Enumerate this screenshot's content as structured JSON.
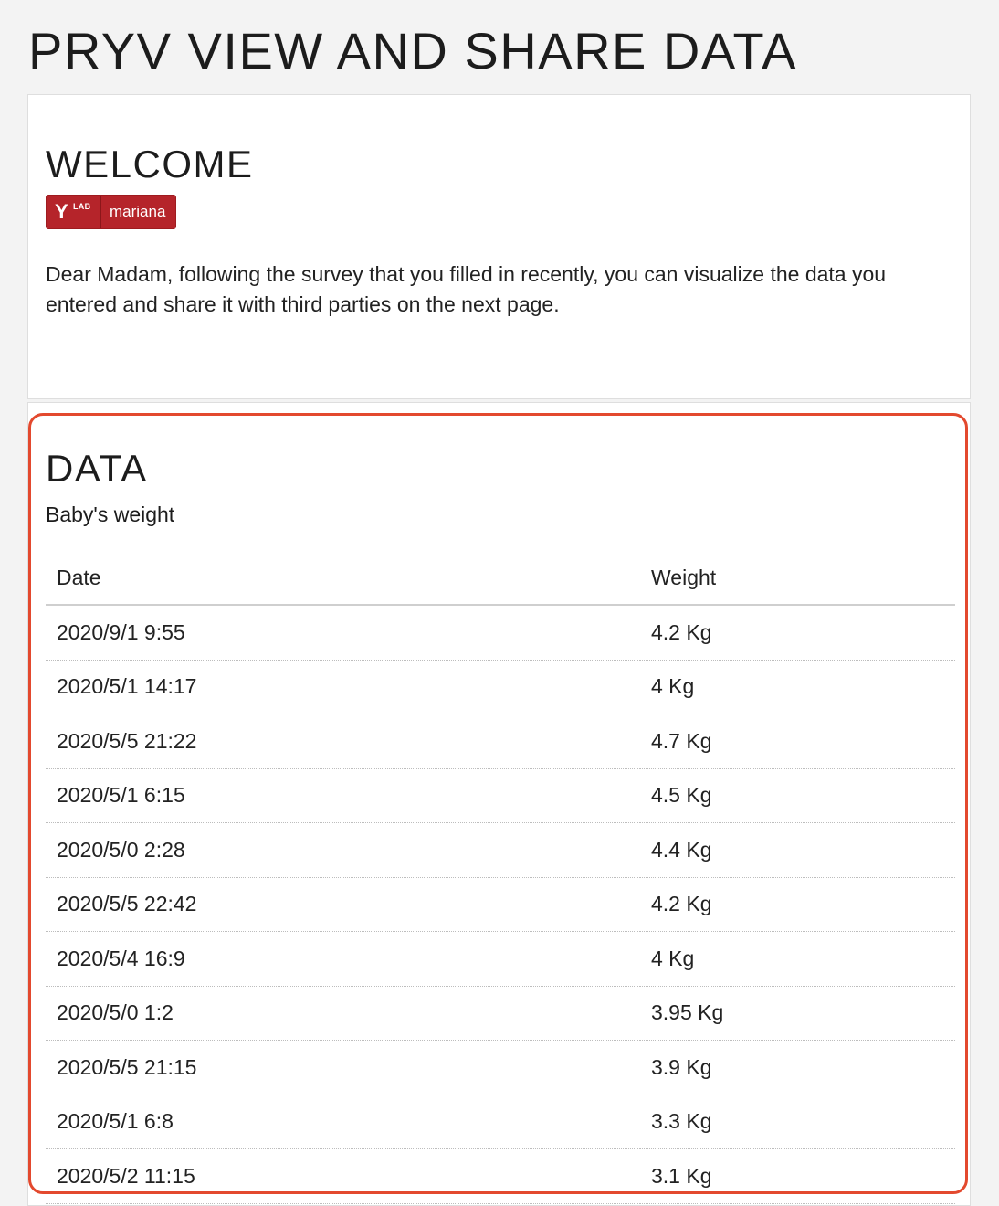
{
  "page": {
    "title": "PRYV VIEW AND SHARE DATA"
  },
  "welcome": {
    "heading": "WELCOME",
    "badge": {
      "logo_letter": "Y",
      "logo_sub": "LAB",
      "username": "mariana",
      "color": "#b5242a"
    },
    "message": "Dear Madam, following the survey that you filled in recently, you can visualize the data you entered and share it with third parties on the next page."
  },
  "data": {
    "heading": "DATA",
    "subheading": "Baby's weight",
    "highlight_color": "#e3492e",
    "table": {
      "headers": [
        "Date",
        "Weight"
      ],
      "rows": [
        [
          "2020/9/1 9:55",
          "4.2 Kg"
        ],
        [
          "2020/5/1 14:17",
          "4 Kg"
        ],
        [
          "2020/5/5 21:22",
          "4.7 Kg"
        ],
        [
          "2020/5/1 6:15",
          "4.5 Kg"
        ],
        [
          "2020/5/0 2:28",
          "4.4 Kg"
        ],
        [
          "2020/5/5 22:42",
          "4.2 Kg"
        ],
        [
          "2020/5/4 16:9",
          "4 Kg"
        ],
        [
          "2020/5/0 1:2",
          "3.95 Kg"
        ],
        [
          "2020/5/5 21:15",
          "3.9 Kg"
        ],
        [
          "2020/5/1 6:8",
          "3.3 Kg"
        ],
        [
          "2020/5/2 11:15",
          "3.1 Kg"
        ]
      ]
    }
  }
}
